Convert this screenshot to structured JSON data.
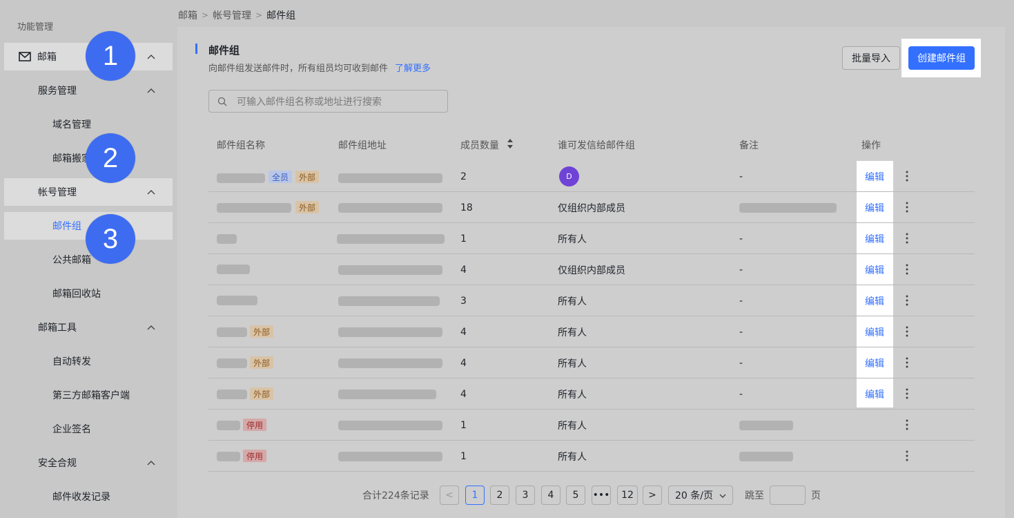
{
  "sidebar": {
    "title": "功能管理",
    "mailbox": "邮箱",
    "service_mgmt": "服务管理",
    "domain_mgmt": "域名管理",
    "mail_migration": "邮箱搬家",
    "account_mgmt": "帐号管理",
    "mail_group": "邮件组",
    "public_mailbox": "公共邮箱",
    "recycle_bin": "邮箱回收站",
    "mail_tools": "邮箱工具",
    "auto_forward": "自动转发",
    "third_party_client": "第三方邮箱客户端",
    "signature": "企业签名",
    "security": "安全合规",
    "mail_log": "邮件收发记录"
  },
  "badges": [
    "1",
    "2",
    "3"
  ],
  "breadcrumb": [
    "邮箱",
    "帐号管理",
    "邮件组"
  ],
  "header": {
    "title": "邮件组",
    "subtitle": "向邮件组发送邮件时，所有组员均可收到邮件",
    "learn_more": "了解更多",
    "import_btn": "批量导入",
    "create_btn": "创建邮件组"
  },
  "search": {
    "placeholder": "可输入邮件组名称或地址进行搜索"
  },
  "table": {
    "columns": [
      "邮件组名称",
      "邮件组地址",
      "成员数量",
      "谁可发信给邮件组",
      "备注",
      "操作"
    ],
    "edit_label": "编辑",
    "avatar_letter": "D",
    "tags": {
      "all": "全员",
      "external": "外部",
      "disabled": "停用"
    },
    "rows": [
      {
        "members": "2",
        "sender": "",
        "note": "-"
      },
      {
        "members": "18",
        "sender": "仅组织内部成员",
        "note": ""
      },
      {
        "members": "1",
        "sender": "所有人",
        "note": "-"
      },
      {
        "members": "4",
        "sender": "仅组织内部成员",
        "note": "-"
      },
      {
        "members": "3",
        "sender": "所有人",
        "note": "-"
      },
      {
        "members": "4",
        "sender": "所有人",
        "note": "-"
      },
      {
        "members": "4",
        "sender": "所有人",
        "note": "-"
      },
      {
        "members": "4",
        "sender": "所有人",
        "note": "-"
      },
      {
        "members": "1",
        "sender": "所有人",
        "note": ""
      },
      {
        "members": "1",
        "sender": "所有人",
        "note": ""
      }
    ]
  },
  "pagination": {
    "total": "合计224条记录",
    "prev": "<",
    "pages": [
      "1",
      "2",
      "3",
      "4",
      "5",
      "•••",
      "12"
    ],
    "next": ">",
    "page_size": "20 条/页",
    "jump_label": "跳至",
    "page_label": "页"
  },
  "colors": {
    "accent": "#3370ff",
    "badge": "#3d6cf0"
  }
}
